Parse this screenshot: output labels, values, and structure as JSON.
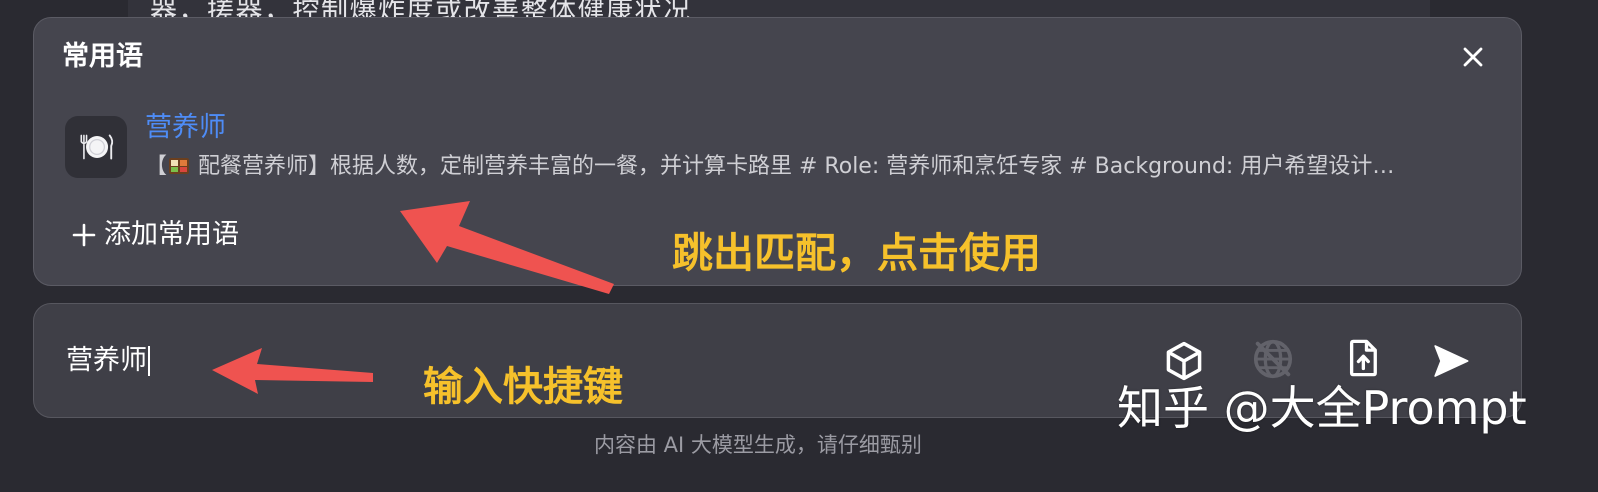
{
  "background_message": {
    "text": "器，搓器，控制爆炸度或改善整体健康状况"
  },
  "popup": {
    "title": "常用语",
    "close_icon": "close-icon",
    "items": [
      {
        "icon": "plate-icon",
        "name": "营养师",
        "description_open": "【",
        "description_emoji": "bento-box-icon",
        "description": " 配餐营养师】根据人数，定制营养丰富的一餐，并计算卡路里 # Role: 营养师和烹饪专家 # Background: 用户希望设计…"
      }
    ],
    "add_icon": "plus-icon",
    "add_label": "添加常用语"
  },
  "input": {
    "value": "营养师",
    "tools": [
      "cube-icon",
      "globe-off-icon",
      "file-upload-icon",
      "send-icon"
    ]
  },
  "annotations": {
    "top": "跳出匹配，点击使用",
    "bottom": "输入快捷键"
  },
  "watermark": "知乎 @大全Prompt",
  "disclaimer": "内容由 AI 大模型生成，请仔细甄别",
  "colors": {
    "accent_blue": "#4e8cf6",
    "annotation_yellow": "#f6c12b",
    "annotation_red": "#ef5350",
    "disabled_icon": "#62626a"
  }
}
